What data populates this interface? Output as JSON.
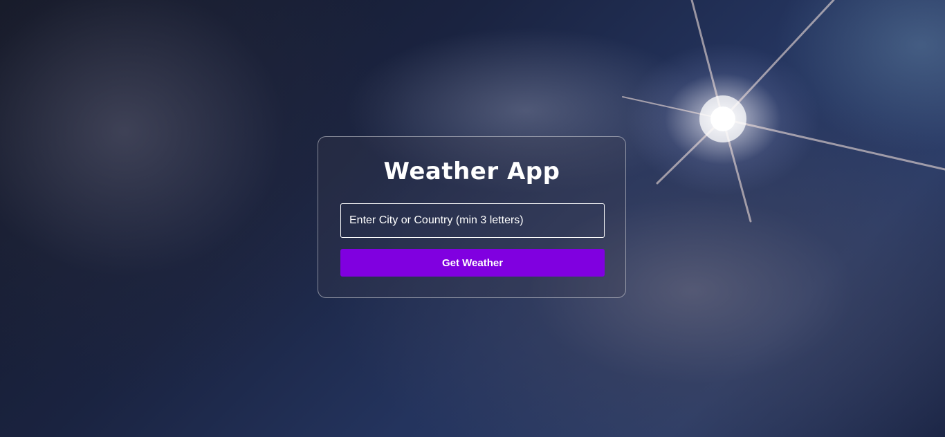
{
  "app": {
    "title": "Weather App"
  },
  "search": {
    "placeholder": "Enter City or Country (min 3 letters)",
    "value": ""
  },
  "actions": {
    "get_weather_label": "Get Weather"
  },
  "colors": {
    "button_accent": "#8000e0",
    "card_border": "#ffffff",
    "text": "#ffffff"
  }
}
